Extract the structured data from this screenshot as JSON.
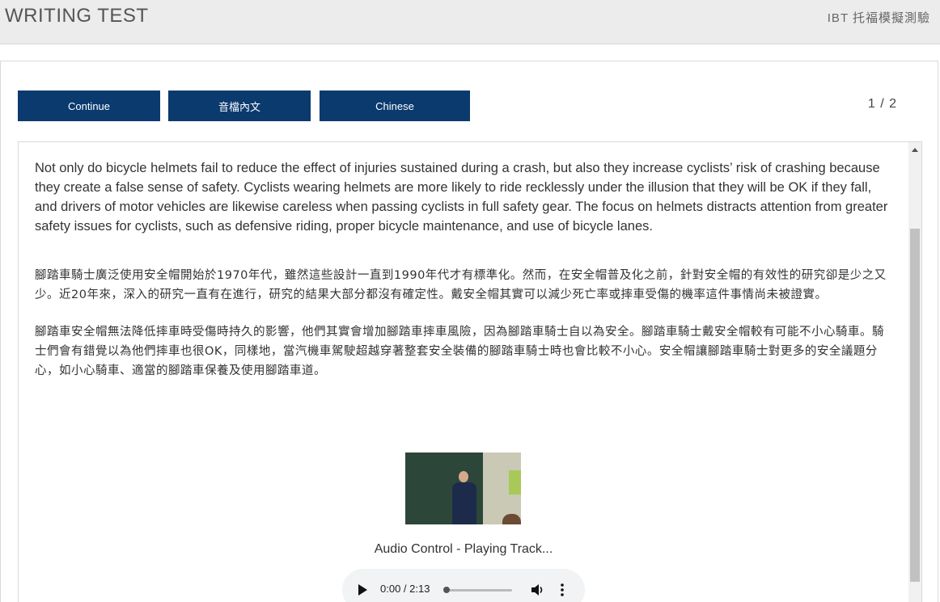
{
  "header": {
    "title": "WRITING TEST",
    "subtitle": "IBT 托福模擬測驗"
  },
  "toolbar": {
    "continue_label": "Continue",
    "transcript_label": "音檔內文",
    "chinese_label": "Chinese",
    "page_indicator": "1 / 2"
  },
  "content": {
    "english_paragraph": "Not only do bicycle helmets fail to reduce the effect of injuries sustained during a crash, but also they increase cyclists’ risk of crashing because they create a false sense of safety. Cyclists wearing helmets are more likely to ride recklessly under the illusion that they will be OK if they fall, and drivers of motor vehicles are likewise careless when passing cyclists in full safety gear. The focus on helmets distracts attention from greater safety issues for cyclists, such as defensive riding, proper bicycle maintenance, and use of bicycle lanes.",
    "chinese_paragraph_1": "腳踏車騎士廣泛使用安全帽開始於1970年代，雖然這些設計一直到1990年代才有標準化。然而，在安全帽普及化之前，針對安全帽的有效性的研究卻是少之又少。近20年來，深入的研究一直有在進行，研究的結果大部分都沒有確定性。戴安全帽其實可以減少死亡率或摔車受傷的機率這件事情尚未被證實。",
    "chinese_paragraph_2": "腳踏車安全帽無法降低摔車時受傷時持久的影響，他們其實會增加腳踏車摔車風險，因為腳踏車騎士自以為安全。腳踏車騎士戴安全帽較有可能不小心騎車。騎士們會有錯覺以為他們摔車也很OK，同樣地，當汽機車駕駛超越穿著整套安全裝備的腳踏車騎士時也會比較不小心。安全帽讓腳踏車騎士對更多的安全議題分心，如小心騎車、適當的腳踏車保養及使用腳踏車道。"
  },
  "media": {
    "audio_label": "Audio Control - Playing Track...",
    "time_display": "0:00 / 2:13",
    "progress": 0
  },
  "icons": {
    "play": "play-icon",
    "volume": "volume-icon",
    "more": "more-vertical-icon",
    "scroll_up": "chevron-up-icon"
  },
  "colors": {
    "button_bg": "#0b3a6e",
    "header_bg": "#ececec"
  }
}
